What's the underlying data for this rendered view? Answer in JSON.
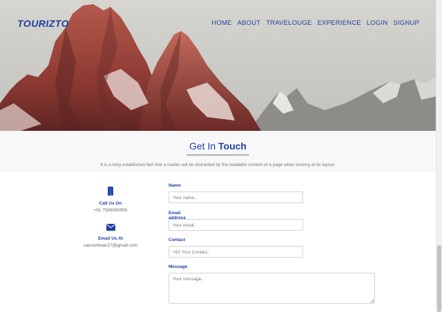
{
  "header": {
    "brand": "TOURIZTO",
    "nav": [
      "HOME",
      "ABOUT",
      "TRAVELOUGE",
      "EXPERIENCE",
      "LOGIN",
      "SIGNUP"
    ]
  },
  "section": {
    "title_plain": "Get In ",
    "title_bold": "Touch",
    "divider": "******************************",
    "description": "It is a long established fact that a reader will be distracted by the readable content of a page when looking at its layout."
  },
  "contact_info": {
    "call": {
      "title": "Call Us On",
      "value": "+91 7506056955",
      "icon": "phone-icon"
    },
    "email": {
      "title": "Email Us At",
      "value": "sauravtiwari27@gmail.com",
      "icon": "envelope-icon"
    }
  },
  "form": {
    "name": {
      "label": "Name",
      "placeholder": "Your name.."
    },
    "email": {
      "label": "Email address",
      "placeholder": "Your email.."
    },
    "contact": {
      "label": "Contact",
      "placeholder": "+91 Your Contact.."
    },
    "message": {
      "label": "Message",
      "placeholder": "Your message.."
    }
  },
  "colors": {
    "accent": "#1f3fa0",
    "muted": "#777777"
  }
}
